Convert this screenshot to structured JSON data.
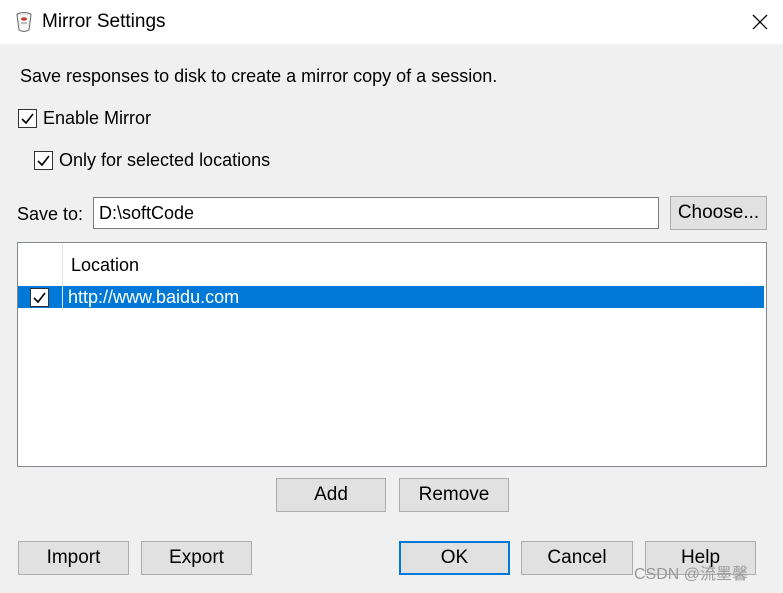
{
  "window": {
    "title": "Mirror Settings",
    "icon": "fiddler-app-icon",
    "close_icon": "close-icon"
  },
  "description": "Save responses to disk to create a mirror copy of a session.",
  "enable_mirror": {
    "label": "Enable Mirror",
    "checked": true
  },
  "only_selected": {
    "label": "Only for selected locations",
    "checked": true
  },
  "save_to": {
    "label": "Save to:",
    "value": "D:\\softCode",
    "choose_label": "Choose..."
  },
  "table": {
    "columns": [
      "",
      "Location"
    ],
    "rows": [
      {
        "checked": true,
        "location": "http://www.baidu.com",
        "selected": true
      }
    ]
  },
  "buttons": {
    "add": "Add",
    "remove": "Remove",
    "import": "Import",
    "export": "Export",
    "ok": "OK",
    "cancel": "Cancel",
    "help": "Help"
  },
  "watermark": "CSDN @流墨馨",
  "colors": {
    "accent": "#0078d7",
    "background": "#f0f0f0"
  }
}
